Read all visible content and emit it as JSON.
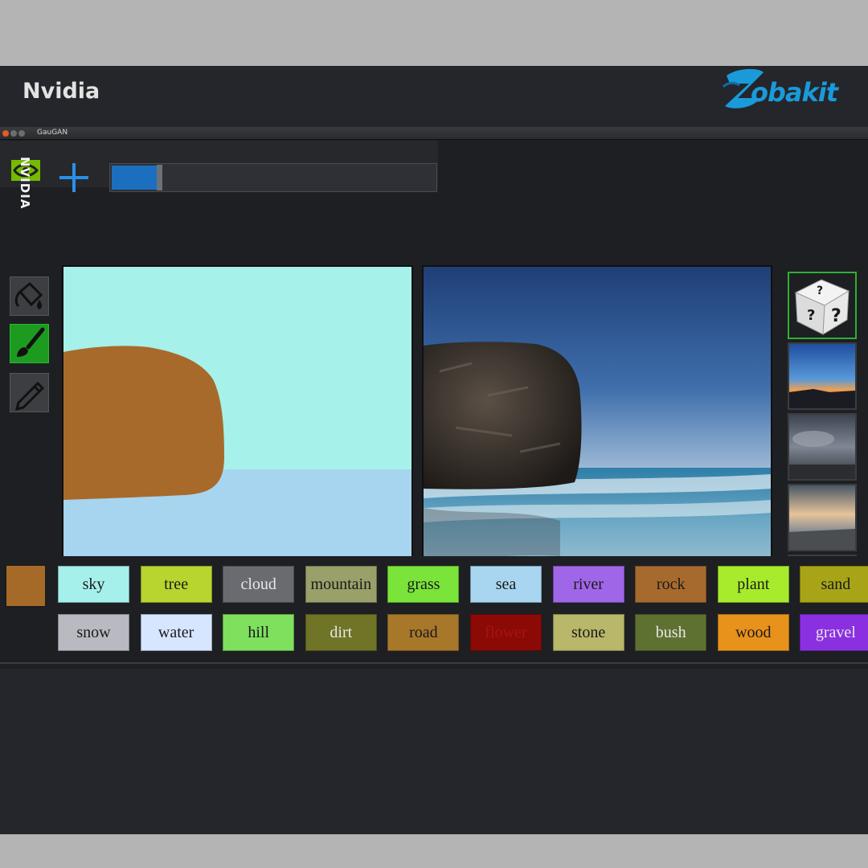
{
  "header": {
    "title": "Nvidia",
    "logo_text": "obakit",
    "logo_color": "#1a9ad9"
  },
  "app": {
    "window_title": "GauGAN",
    "vendor_mark": "NVIDIA",
    "progress_fraction": 0.14,
    "tools": [
      {
        "name": "paint-bucket",
        "active": false
      },
      {
        "name": "brush",
        "active": true
      },
      {
        "name": "pencil",
        "active": false
      }
    ],
    "current_color": "#a66a28"
  },
  "labels": {
    "row1": [
      {
        "label": "sky",
        "color": "#a6f0ec",
        "text_color": "#1a1a1a"
      },
      {
        "label": "tree",
        "color": "#b8d42f",
        "text_color": "#1a1a1a"
      },
      {
        "label": "cloud",
        "color": "#6a6b70",
        "text_color": "#e8e8e8"
      },
      {
        "label": "mountain",
        "color": "#9aa06a",
        "text_color": "#1a1a1a"
      },
      {
        "label": "grass",
        "color": "#7be43a",
        "text_color": "#1a1a1a"
      },
      {
        "label": "sea",
        "color": "#a8d6f0",
        "text_color": "#1a1a1a"
      },
      {
        "label": "river",
        "color": "#a066e8",
        "text_color": "#1a1a1a"
      },
      {
        "label": "rock",
        "color": "#a66a2e",
        "text_color": "#1a1a1a"
      },
      {
        "label": "plant",
        "color": "#a8ea2c",
        "text_color": "#1a1a1a"
      },
      {
        "label": "sand",
        "color": "#a8a418",
        "text_color": "#1a1a1a"
      }
    ],
    "row2": [
      {
        "label": "snow",
        "color": "#b9b9c2",
        "text_color": "#1a1a1a"
      },
      {
        "label": "water",
        "color": "#d6e6ff",
        "text_color": "#1a1a1a"
      },
      {
        "label": "hill",
        "color": "#7fe05e",
        "text_color": "#1a1a1a"
      },
      {
        "label": "dirt",
        "color": "#6f7426",
        "text_color": "#e8e8e8"
      },
      {
        "label": "road",
        "color": "#a8782a",
        "text_color": "#1a1a1a"
      },
      {
        "label": "flower",
        "color": "#8c0a06",
        "text_color": "#a51414"
      },
      {
        "label": "stone",
        "color": "#b8b76a",
        "text_color": "#1a1a1a"
      },
      {
        "label": "bush",
        "color": "#5f7131",
        "text_color": "#e8e8e8"
      },
      {
        "label": "wood",
        "color": "#e8921c",
        "text_color": "#1a1a1a"
      },
      {
        "label": "gravel",
        "color": "#8a30e0",
        "text_color": "#e8e8e8"
      }
    ]
  }
}
